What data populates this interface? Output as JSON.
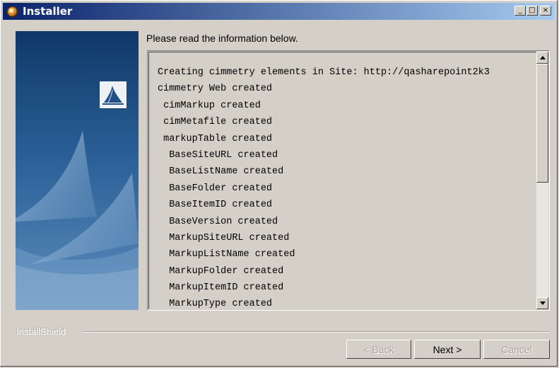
{
  "window": {
    "title": "Installer",
    "controls": {
      "minimize": "_",
      "maximize": "□",
      "close": "×"
    }
  },
  "content": {
    "intro": "Please read the information below.",
    "log_lines": [
      "Creating cimmetry elements in Site: http://qasharepoint2k3",
      "cimmetry Web created",
      " cimMarkup created",
      " cimMetafile created",
      " markupTable created",
      "  BaseSiteURL created",
      "  BaseListName created",
      "  BaseFolder created",
      "  BaseItemID created",
      "  BaseVersion created",
      "  MarkupSiteURL created",
      "  MarkupListName created",
      "  MarkupFolder created",
      "  MarkupItemID created",
      "  MarkupType created"
    ]
  },
  "footer": {
    "brand": "InstallShield",
    "buttons": {
      "back": "< Back",
      "next": "Next >",
      "cancel": "Cancel"
    }
  },
  "icons": {
    "app": "installer-app-icon",
    "logo": "sails-logo-icon"
  },
  "colors": {
    "titlebar_start": "#0a246a",
    "titlebar_end": "#a6caf0",
    "window_face": "#d4d0c8",
    "side_panel": "#1c4c7e"
  }
}
